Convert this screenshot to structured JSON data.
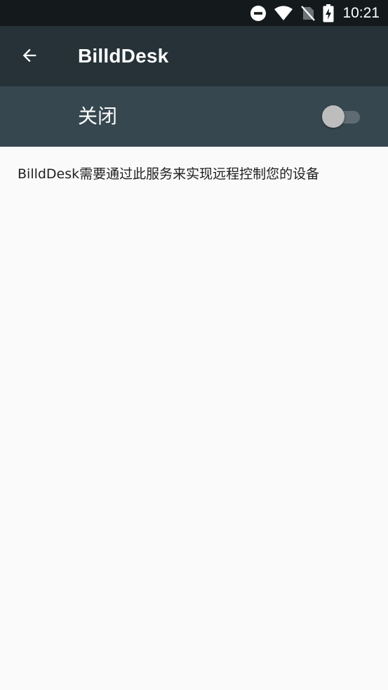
{
  "status_bar": {
    "time": "10:21",
    "icons": [
      "do-not-disturb-icon",
      "wifi-icon",
      "no-sim-icon",
      "battery-charging-icon"
    ]
  },
  "app_bar": {
    "back_icon": "arrow-back-icon",
    "title": "BilldDesk"
  },
  "switch_bar": {
    "label": "关闭",
    "switch_on": false
  },
  "content": {
    "description": "BilldDesk需要通过此服务来实现远程控制您的设备"
  },
  "colors": {
    "status_bar_bg": "#14191c",
    "app_bar_bg": "#263238",
    "switch_bar_bg": "#37474f",
    "page_bg": "#fafafa",
    "text_primary": "#212121"
  }
}
